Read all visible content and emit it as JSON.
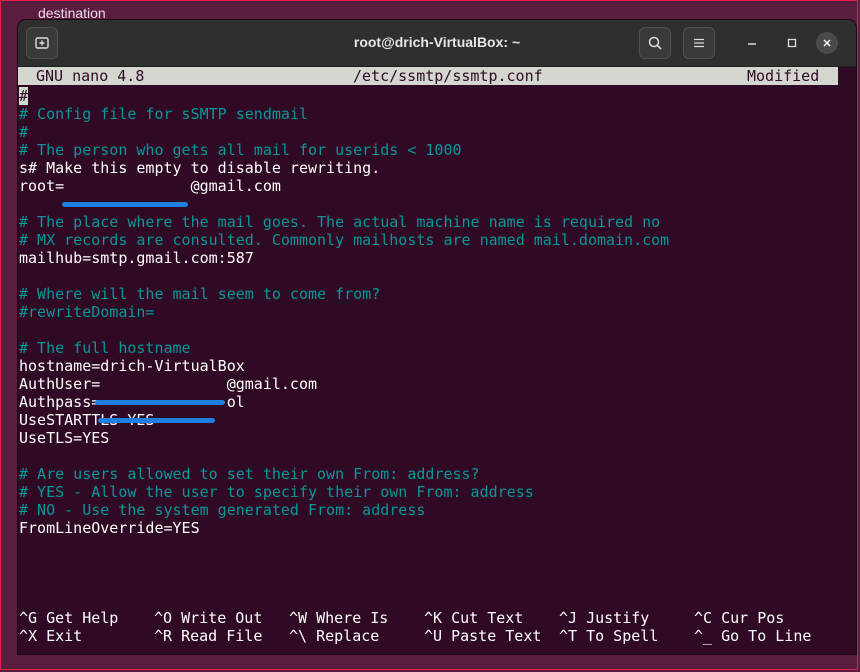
{
  "background": {
    "window_title": "destination"
  },
  "window": {
    "title": "root@drich-VirtualBox: ~",
    "icons": [
      "new-tab-icon",
      "search-icon",
      "hamburger-menu-icon",
      "minimize-icon",
      "maximize-icon",
      "close-icon"
    ]
  },
  "nano": {
    "version": "GNU nano 4.8",
    "file": "/etc/ssmtp/ssmtp.conf",
    "status": "Modified"
  },
  "lines": [
    {
      "text": "#",
      "type": "comment"
    },
    {
      "text": "# Config file for sSMTP sendmail",
      "type": "comment"
    },
    {
      "text": "#",
      "type": "comment"
    },
    {
      "text": "# The person who gets all mail for userids < 1000",
      "type": "comment"
    },
    {
      "text": "s# Make this empty to disable rewriting.",
      "type": "plain"
    },
    {
      "text": "root=              @gmail.com",
      "type": "plain"
    },
    {
      "text": "",
      "type": "plain"
    },
    {
      "text": "# The place where the mail goes. The actual machine name is required no",
      "type": "comment"
    },
    {
      "text": "# MX records are consulted. Commonly mailhosts are named mail.domain.com",
      "type": "comment"
    },
    {
      "text": "mailhub=smtp.gmail.com:587",
      "type": "plain"
    },
    {
      "text": "",
      "type": "plain"
    },
    {
      "text": "# Where will the mail seem to come from?",
      "type": "comment"
    },
    {
      "text": "#rewriteDomain=",
      "type": "comment"
    },
    {
      "text": "",
      "type": "plain"
    },
    {
      "text": "# The full hostname",
      "type": "comment"
    },
    {
      "text": "hostname=drich-VirtualBox",
      "type": "plain"
    },
    {
      "text": "AuthUser=              @gmail.com",
      "type": "plain"
    },
    {
      "text": "Authpass=              ol",
      "type": "plain"
    },
    {
      "text": "UseSTARTTLS=YES",
      "type": "plain"
    },
    {
      "text": "UseTLS=YES",
      "type": "plain"
    },
    {
      "text": "",
      "type": "plain"
    },
    {
      "text": "# Are users allowed to set their own From: address?",
      "type": "comment"
    },
    {
      "text": "# YES - Allow the user to specify their own From: address",
      "type": "comment"
    },
    {
      "text": "# NO - Use the system generated From: address",
      "type": "comment"
    },
    {
      "text": "FromLineOverride=YES",
      "type": "plain"
    }
  ],
  "shortcuts": [
    {
      "key": "^G",
      "label": "Get Help"
    },
    {
      "key": "^O",
      "label": "Write Out"
    },
    {
      "key": "^W",
      "label": "Where Is"
    },
    {
      "key": "^K",
      "label": "Cut Text"
    },
    {
      "key": "^J",
      "label": "Justify"
    },
    {
      "key": "^C",
      "label": "Cur Pos"
    },
    {
      "key": "^X",
      "label": "Exit"
    },
    {
      "key": "^R",
      "label": "Read File"
    },
    {
      "key": "^\\",
      "label": "Replace"
    },
    {
      "key": "^U",
      "label": "Paste Text"
    },
    {
      "key": "^T",
      "label": "To Spell"
    },
    {
      "key": "^_",
      "label": "Go To Line"
    }
  ]
}
